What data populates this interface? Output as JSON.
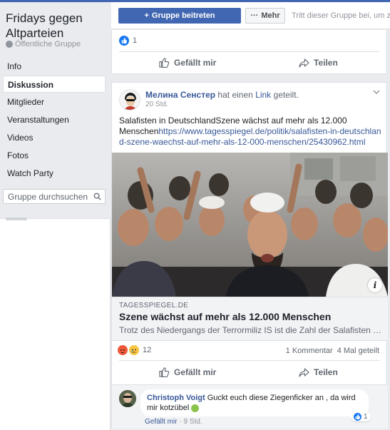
{
  "group": {
    "title": "Fridays gegen Altparteien",
    "privacy": "Öffentliche Gruppe"
  },
  "nav": {
    "items": [
      "Info",
      "Diskussion",
      "Mitglieder",
      "Veranstaltungen",
      "Videos",
      "Fotos",
      "Watch Party"
    ],
    "active": "Diskussion"
  },
  "search": {
    "placeholder": "Gruppe durchsuchen"
  },
  "header": {
    "join_label": "Gruppe beitreten",
    "more_label": "Mehr",
    "hint": "Tritt dieser Gruppe bei, um zu p"
  },
  "previous_post": {
    "like_count": "1",
    "like_label": "Gefällt mir",
    "share_label": "Teilen"
  },
  "post": {
    "author": "Мелина Сенстер",
    "action_pre": "hat einen",
    "action_link": "Link",
    "action_post": "geteilt.",
    "time": "20 Std.",
    "text": "Salafisten in DeutschlandSzene wächst auf mehr als 12.000 Menschen",
    "url": "https://www.tagesspiegel.de/politik/salafisten-in-deutschland-szene-waechst-auf-mehr-als-12-000-menschen/25430962.html",
    "link_domain": "TAGESSPIEGEL.DE",
    "link_title": "Szene wächst auf mehr als 12.000 Menschen",
    "link_desc": "Trotz des Niedergangs der Terrormiliz IS ist die Zahl der Salafisten jetzt ...",
    "reaction_count": "12",
    "comment_count": "1 Kommentar",
    "share_count": "4 Mal geteilt",
    "like_label": "Gefällt mir",
    "share_label": "Teilen"
  },
  "comment": {
    "author": "Christoph Voigt",
    "text": "Guckt euch diese Ziegenficker an , da wird mir kotzübel",
    "like_count": "1",
    "like_action": "Gefällt mir",
    "time": "9 Std."
  },
  "colors": {
    "brand": "#4267b2",
    "link": "#385898",
    "background": "#e9ebee"
  }
}
